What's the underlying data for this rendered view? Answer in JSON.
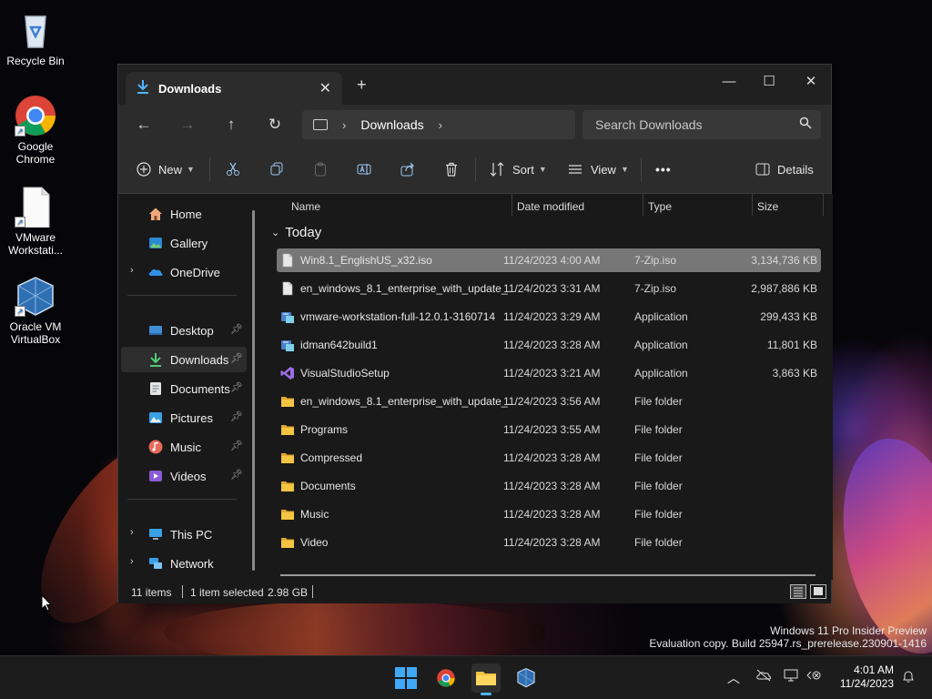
{
  "desktop": {
    "icons": [
      {
        "label": "Recycle Bin"
      },
      {
        "label": "Google Chrome"
      },
      {
        "label": "VMware Workstati..."
      },
      {
        "label": "Oracle VM VirtualBox"
      }
    ]
  },
  "window": {
    "tab_title": "Downloads",
    "breadcrumb": [
      "Downloads"
    ],
    "search_placeholder": "Search Downloads"
  },
  "toolbar": {
    "new_label": "New",
    "sort_label": "Sort",
    "view_label": "View",
    "more_label": "•••",
    "details_label": "Details"
  },
  "sidebar": {
    "items": [
      {
        "label": "Home"
      },
      {
        "label": "Gallery"
      },
      {
        "label": "OneDrive"
      },
      {
        "label": "Desktop"
      },
      {
        "label": "Downloads"
      },
      {
        "label": "Documents"
      },
      {
        "label": "Pictures"
      },
      {
        "label": "Music"
      },
      {
        "label": "Videos"
      },
      {
        "label": "This PC"
      },
      {
        "label": "Network"
      }
    ]
  },
  "columns": {
    "name": "Name",
    "date": "Date modified",
    "type": "Type",
    "size": "Size"
  },
  "group_label": "Today",
  "files": [
    {
      "name": "Win8.1_EnglishUS_x32.iso",
      "date": "11/24/2023 4:00 AM",
      "type": "7-Zip.iso",
      "size": "3,134,736 KB",
      "icon": "file-icon"
    },
    {
      "name": "en_windows_8.1_enterprise_with_update_...",
      "date": "11/24/2023 3:31 AM",
      "type": "7-Zip.iso",
      "size": "2,987,886 KB",
      "icon": "file-icon"
    },
    {
      "name": "vmware-workstation-full-12.0.1-3160714",
      "date": "11/24/2023 3:29 AM",
      "type": "Application",
      "size": "299,433 KB",
      "icon": "installer-icon"
    },
    {
      "name": "idman642build1",
      "date": "11/24/2023 3:28 AM",
      "type": "Application",
      "size": "11,801 KB",
      "icon": "installer-icon"
    },
    {
      "name": "VisualStudioSetup",
      "date": "11/24/2023 3:21 AM",
      "type": "Application",
      "size": "3,863 KB",
      "icon": "visual-studio-icon"
    },
    {
      "name": "en_windows_8.1_enterprise_with_update_...",
      "date": "11/24/2023 3:56 AM",
      "type": "File folder",
      "size": "",
      "icon": "folder-icon"
    },
    {
      "name": "Programs",
      "date": "11/24/2023 3:55 AM",
      "type": "File folder",
      "size": "",
      "icon": "folder-icon"
    },
    {
      "name": "Compressed",
      "date": "11/24/2023 3:28 AM",
      "type": "File folder",
      "size": "",
      "icon": "folder-icon"
    },
    {
      "name": "Documents",
      "date": "11/24/2023 3:28 AM",
      "type": "File folder",
      "size": "",
      "icon": "folder-icon"
    },
    {
      "name": "Music",
      "date": "11/24/2023 3:28 AM",
      "type": "File folder",
      "size": "",
      "icon": "folder-icon"
    },
    {
      "name": "Video",
      "date": "11/24/2023 3:28 AM",
      "type": "File folder",
      "size": "",
      "icon": "folder-icon"
    }
  ],
  "status": {
    "count": "11 items",
    "selection": "1 item selected",
    "size": "2.98 GB"
  },
  "watermark": {
    "line1": "Windows 11 Pro Insider Preview",
    "line2": "Evaluation copy. Build 25947.rs_prerelease.230901-1416"
  },
  "clock": {
    "time": "4:01 AM",
    "date": "11/24/2023"
  },
  "colors": {
    "accent": "#4fb5ff",
    "folder": "#f4c542",
    "selected_row": "#777777"
  }
}
